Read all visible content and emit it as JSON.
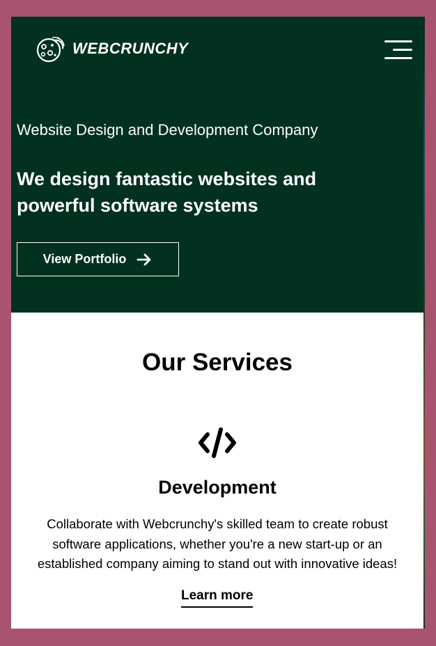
{
  "header": {
    "brand": "WEBCRUNCHY",
    "logo_icon": "cookie-logo-icon",
    "menu_icon": "hamburger-menu-icon"
  },
  "hero": {
    "tagline": "Website Design and Development Company",
    "headline": "We design fantastic websites and powerful software systems",
    "portfolio_button": {
      "label": "View Portfolio",
      "icon": "arrow-right-icon"
    }
  },
  "services": {
    "title": "Our Services",
    "items": [
      {
        "icon": "code-icon",
        "title": "Development",
        "description": "Collaborate with Webcrunchy's skilled team to create robust software applications, whether you're a new start-up or an established company aiming to stand out with innovative ideas!",
        "link": "Learn more"
      }
    ]
  },
  "colors": {
    "hero_background": "#02311f",
    "page_background": "#a8546e",
    "content_background": "#ffffff",
    "text_dark": "#000000",
    "text_light": "#ffffff"
  }
}
